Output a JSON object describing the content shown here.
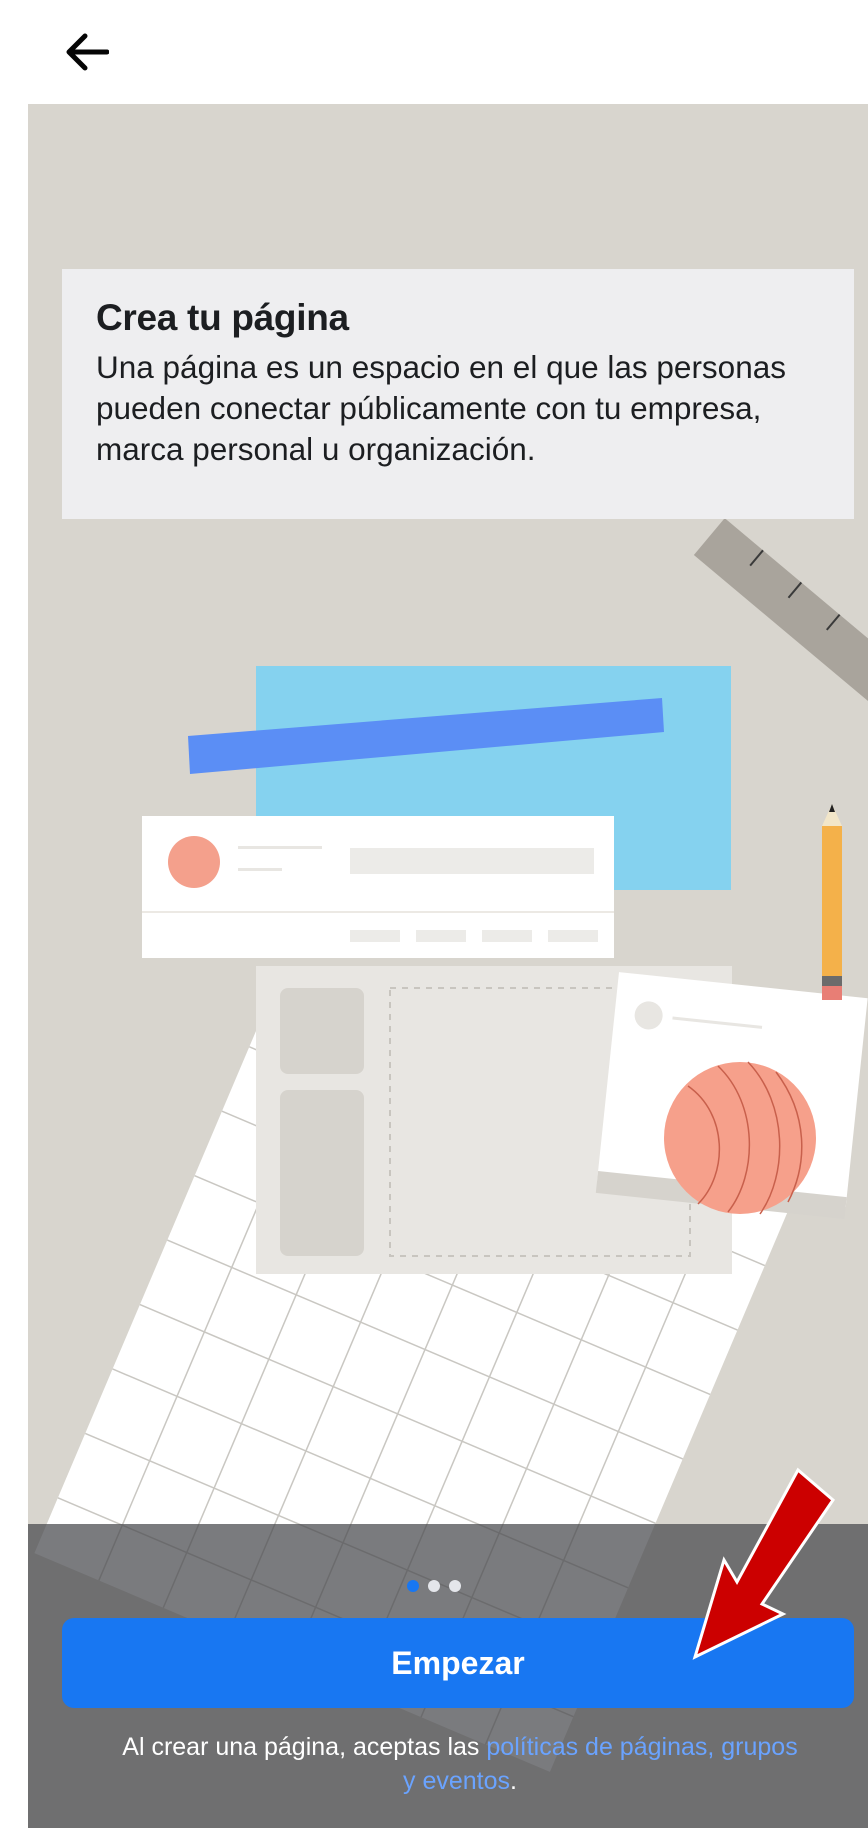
{
  "header": {
    "back_icon": "arrow-left-icon"
  },
  "card": {
    "title": "Crea tu página",
    "description": "Una página es un espacio en el que las personas pueden conectar públicamente con tu empresa, marca personal u organización."
  },
  "pagination": {
    "total": 3,
    "active": 1
  },
  "cta": {
    "label": "Empezar"
  },
  "terms": {
    "prefix": "Al crear una página, aceptas las",
    "link": "políticas de páginas, grupos y eventos",
    "suffix": "."
  },
  "annotation": {
    "arrow_color": "#cc0000"
  },
  "colors": {
    "accent": "#1877f2",
    "hero_bg": "#d8d5ce"
  }
}
